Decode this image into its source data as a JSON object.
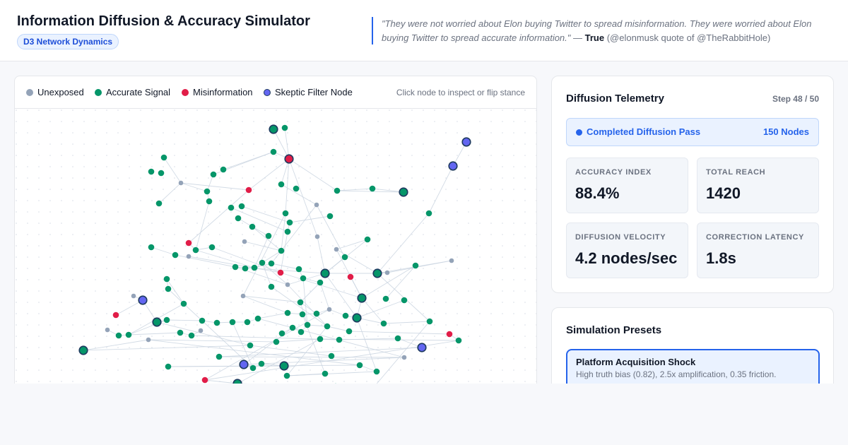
{
  "header": {
    "title": "Information Diffusion & Accuracy Simulator",
    "badge": "D3 Network Dynamics",
    "quote_text": "\"They were not worried about Elon buying Twitter to spread misinformation. They were worried about Elon buying Twitter to spread accurate information.\"",
    "quote_dash": " — ",
    "quote_verdict": "True",
    "quote_attribution": " (@elonmusk quote of @TheRabbitHole)"
  },
  "legend": {
    "items": [
      {
        "label": "Unexposed",
        "color": "#94a3b8"
      },
      {
        "label": "Accurate Signal",
        "color": "#059669"
      },
      {
        "label": "Misinformation",
        "color": "#e11d48"
      },
      {
        "label": "Skeptic Filter Node",
        "color": "#6366f1"
      }
    ],
    "hint": "Click node to inspect or flip stance"
  },
  "telemetry": {
    "title": "Diffusion Telemetry",
    "step": "Step 48 / 50",
    "status_label": "Completed Diffusion Pass",
    "status_count": "150 Nodes",
    "metrics": [
      {
        "label": "ACCURACY INDEX",
        "value": "88.4%"
      },
      {
        "label": "TOTAL REACH",
        "value": "1420"
      },
      {
        "label": "DIFFUSION VELOCITY",
        "value": "4.2 nodes/sec"
      },
      {
        "label": "CORRECTION LATENCY",
        "value": "1.8s"
      }
    ]
  },
  "presets": {
    "title": "Simulation Presets",
    "items": [
      {
        "title": "Platform Acquisition Shock",
        "description": "High truth bias (0.82), 2.5x amplification, 0.35 friction."
      }
    ]
  },
  "colors": {
    "unexposed": "#94a3b8",
    "accurate": "#059669",
    "misinformation": "#e11d48",
    "skeptic_fill": "#6366f1",
    "hub_stroke": "#1e3a5f",
    "edge": "#cbd5e1",
    "accent": "#2563eb"
  },
  "network": {
    "node_count": 150
  }
}
